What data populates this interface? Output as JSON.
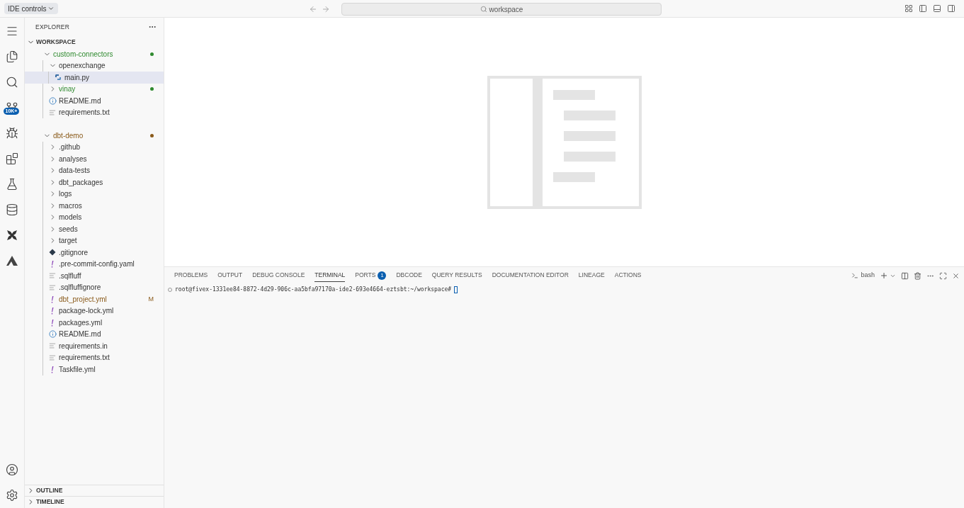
{
  "top_bar": {
    "ide_controls": "IDE controls",
    "search": "workspace"
  },
  "activity_bar": {
    "source_control_badge": "10K+"
  },
  "explorer": {
    "title": "EXPLORER",
    "section": "WORKSPACE",
    "section_expanded": true,
    "tree": [
      {
        "name": "custom-connectors",
        "kind": "folder",
        "expanded": true,
        "selected": false,
        "color": "#2f8a2f",
        "children": [
          {
            "name": "openexchange",
            "kind": "folder",
            "expanded": true,
            "selected": false,
            "children": [
              {
                "name": "main.py",
                "kind": "python",
                "selected": true
              }
            ]
          },
          {
            "name": "vinay",
            "kind": "folder",
            "expanded": false,
            "selected": false,
            "color": "#2f8a2f"
          },
          {
            "name": "README.md",
            "kind": "info",
            "selected": false
          },
          {
            "name": "requirements.txt",
            "kind": "text",
            "selected": false
          }
        ]
      },
      {
        "name": "dbt-demo",
        "kind": "folder",
        "expanded": true,
        "selected": false,
        "color": "#8a5a1a",
        "children": [
          {
            "name": ".github",
            "kind": "folder",
            "expanded": false,
            "selected": false
          },
          {
            "name": "analyses",
            "kind": "folder",
            "expanded": false,
            "selected": false
          },
          {
            "name": "data-tests",
            "kind": "folder",
            "expanded": false,
            "selected": false
          },
          {
            "name": "dbt_packages",
            "kind": "folder",
            "expanded": false,
            "selected": false
          },
          {
            "name": "logs",
            "kind": "folder",
            "expanded": false,
            "selected": false
          },
          {
            "name": "macros",
            "kind": "folder",
            "expanded": false,
            "selected": false
          },
          {
            "name": "models",
            "kind": "folder",
            "expanded": false,
            "selected": false
          },
          {
            "name": "seeds",
            "kind": "folder",
            "expanded": false,
            "selected": false
          },
          {
            "name": "target",
            "kind": "folder",
            "expanded": false,
            "selected": false
          },
          {
            "name": ".gitignore",
            "kind": "git",
            "selected": false
          },
          {
            "name": ".pre-commit-config.yaml",
            "kind": "yaml",
            "selected": false
          },
          {
            "name": ".sqlfluff",
            "kind": "text",
            "selected": false
          },
          {
            "name": ".sqlfluffignore",
            "kind": "text",
            "selected": false
          },
          {
            "name": "dbt_project.yml",
            "kind": "yaml",
            "selected": false,
            "badge": "M"
          },
          {
            "name": "package-lock.yml",
            "kind": "yaml",
            "selected": false
          },
          {
            "name": "packages.yml",
            "kind": "yaml",
            "selected": false
          },
          {
            "name": "README.md",
            "kind": "info",
            "selected": false
          },
          {
            "name": "requirements.in",
            "kind": "text",
            "selected": false
          },
          {
            "name": "requirements.txt",
            "kind": "text",
            "selected": false
          },
          {
            "name": "Taskfile.yml",
            "kind": "yaml",
            "selected": false
          }
        ]
      }
    ],
    "bottom_sections": [
      {
        "title": "OUTLINE",
        "expanded": false
      },
      {
        "title": "TIMELINE",
        "expanded": false
      }
    ]
  },
  "panel": {
    "tabs": [
      {
        "label": "PROBLEMS",
        "selected": false
      },
      {
        "label": "OUTPUT",
        "selected": false
      },
      {
        "label": "DEBUG CONSOLE",
        "selected": false
      },
      {
        "label": "TERMINAL",
        "selected": true
      },
      {
        "label": "PORTS",
        "selected": false,
        "badge": "1"
      },
      {
        "label": "DBCODE",
        "selected": false
      },
      {
        "label": "QUERY RESULTS",
        "selected": false
      },
      {
        "label": "DOCUMENTATION EDITOR",
        "selected": false
      },
      {
        "label": "LINEAGE",
        "selected": false
      },
      {
        "label": "ACTIONS",
        "selected": false
      }
    ],
    "terminal_name": "bash",
    "terminal_line": "root@fivex-1331ee84-8872-4d29-906c-aa5bfa97170a-ide2-693e4664-eztsbt:~/workspace#"
  }
}
